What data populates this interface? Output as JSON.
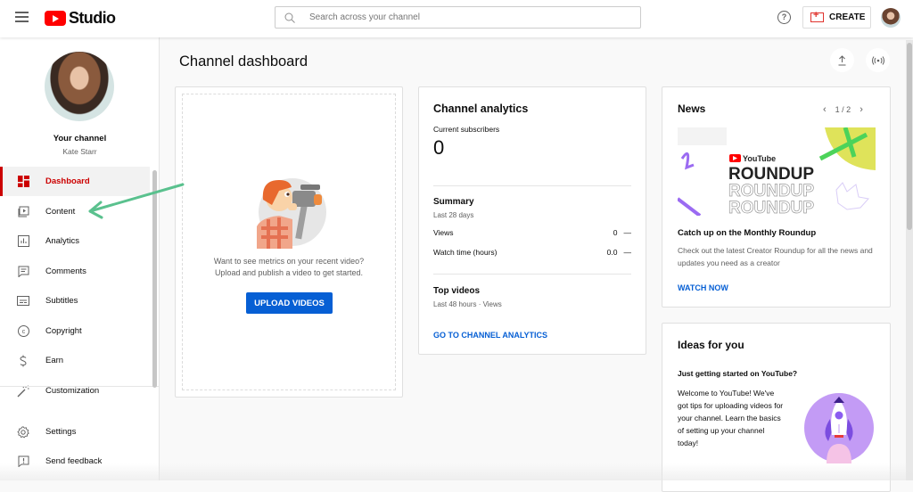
{
  "header": {
    "app_name": "Studio",
    "search_placeholder": "Search across your channel",
    "create_label": "CREATE",
    "help_icon": "?"
  },
  "sidebar": {
    "channel_title": "Your channel",
    "channel_name": "Kate Starr",
    "items": [
      {
        "label": "Dashboard",
        "icon": "dashboard-icon",
        "active": true
      },
      {
        "label": "Content",
        "icon": "content-icon"
      },
      {
        "label": "Analytics",
        "icon": "analytics-icon"
      },
      {
        "label": "Comments",
        "icon": "comments-icon"
      },
      {
        "label": "Subtitles",
        "icon": "subtitles-icon"
      },
      {
        "label": "Copyright",
        "icon": "copyright-icon"
      },
      {
        "label": "Earn",
        "icon": "dollar-icon"
      },
      {
        "label": "Customization",
        "icon": "magic-wand-icon"
      }
    ],
    "bottom_items": [
      {
        "label": "Settings",
        "icon": "gear-icon"
      },
      {
        "label": "Send feedback",
        "icon": "feedback-icon"
      }
    ]
  },
  "main": {
    "page_title": "Channel dashboard",
    "upload_card": {
      "text_line1": "Want to see metrics on your recent video?",
      "text_line2": "Upload and publish a video to get started.",
      "button": "UPLOAD VIDEOS"
    },
    "analytics_card": {
      "title": "Channel analytics",
      "subscribers_label": "Current subscribers",
      "subscribers_value": "0",
      "summary_title": "Summary",
      "summary_period": "Last 28 days",
      "rows": [
        {
          "label": "Views",
          "value": "0",
          "trend": "—"
        },
        {
          "label": "Watch time (hours)",
          "value": "0.0",
          "trend": "—"
        }
      ],
      "top_videos_title": "Top videos",
      "top_videos_sub": "Last 48 hours · Views",
      "link": "GO TO CHANNEL ANALYTICS"
    },
    "news_card": {
      "title": "News",
      "pager": "1 / 2",
      "image_brand": "YouTube",
      "image_word": "ROUNDUP",
      "headline": "Catch up on the Monthly Roundup",
      "description": "Check out the latest Creator Roundup for all the news and updates you need as a creator",
      "link": "WATCH NOW"
    },
    "ideas_card": {
      "title": "Ideas for you",
      "heading": "Just getting started on YouTube?",
      "text": "Welcome to YouTube! We've got tips for uploading videos for your channel. Learn the basics of setting up your channel today!"
    }
  },
  "colors": {
    "accent_red": "#cc0000",
    "link_blue": "#065fd4",
    "annotation_green": "#5ac18e"
  }
}
